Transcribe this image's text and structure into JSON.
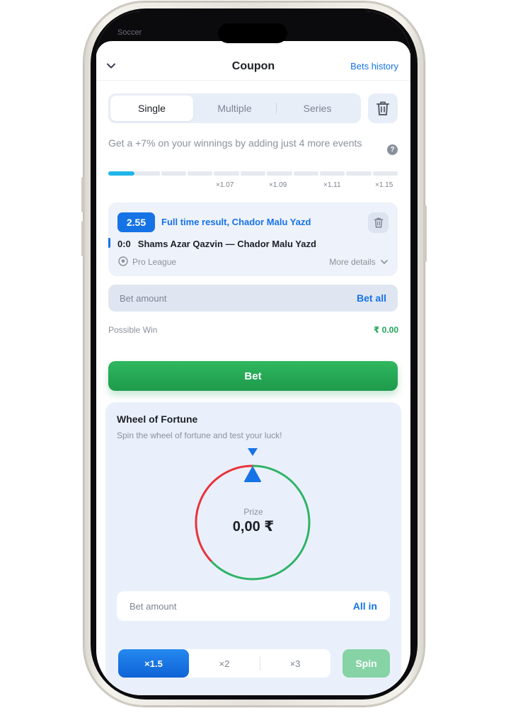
{
  "status_bar": {
    "carrier": "Soccer"
  },
  "header": {
    "title": "Coupon",
    "history_link": "Bets history"
  },
  "tabs": [
    {
      "label": "Single",
      "active": true
    },
    {
      "label": "Multiple",
      "active": false
    },
    {
      "label": "Series",
      "active": false
    }
  ],
  "promo": {
    "text": "Get a +7% on your winnings by adding just 4 more events"
  },
  "progress": {
    "filled_fraction": 0.09,
    "segments": 11,
    "multipliers": [
      "×1.07",
      "×1.09",
      "×1.11",
      "×1.15"
    ]
  },
  "bet": {
    "odds": "2.55",
    "market": "Full time result, Chador Malu Yazd",
    "score": "0:0",
    "teams": "Shams Azar Qazvin — Chador Malu Yazd",
    "league": "Pro League",
    "more_details": "More details"
  },
  "bet_amount": {
    "placeholder": "Bet amount",
    "action": "Bet all"
  },
  "possible_win": {
    "label": "Possible Win",
    "value": "₹ 0.00"
  },
  "bet_button": {
    "label": "Bet"
  },
  "wheel": {
    "title": "Wheel of Fortune",
    "subtitle": "Spin the wheel of fortune and test your luck!",
    "prize_label": "Prize",
    "prize_value": "0,00 ₹",
    "amount_placeholder": "Bet amount",
    "amount_action": "All in",
    "multipliers": [
      {
        "label": "×1.5",
        "active": true
      },
      {
        "label": "×2",
        "active": false
      },
      {
        "label": "×3",
        "active": false
      }
    ],
    "spin_label": "Spin"
  },
  "colors": {
    "accent": "#1673e6",
    "green": "#21a55a",
    "red": "#e8333b",
    "cyan": "#22b5ea"
  }
}
